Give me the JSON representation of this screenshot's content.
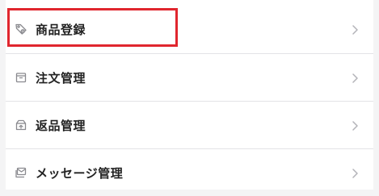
{
  "menu": {
    "items": [
      {
        "label": "商品登録",
        "icon": "tag-icon"
      },
      {
        "label": "注文管理",
        "icon": "box-icon"
      },
      {
        "label": "返品管理",
        "icon": "return-box-icon"
      },
      {
        "label": "メッセージ管理",
        "icon": "message-icon"
      }
    ]
  },
  "colors": {
    "highlight": "#e0262e",
    "text": "#222222",
    "icon": "#8a8a8f",
    "chevron": "#b3b3b8"
  }
}
